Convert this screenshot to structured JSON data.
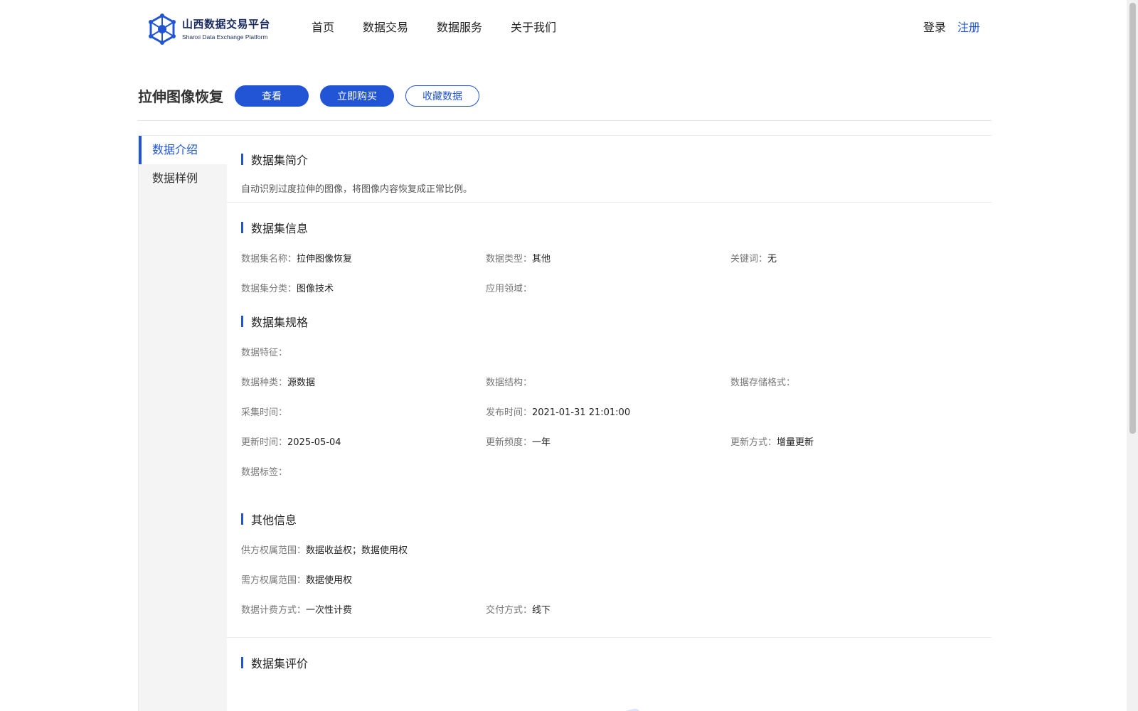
{
  "brand": {
    "name_cn": "山西数据交易平台",
    "name_en": "Shanxi Data Exchange Platform",
    "logo_icon": "hexagon-network-logo",
    "color": "#2155d6"
  },
  "nav": {
    "items": [
      {
        "label": "首页"
      },
      {
        "label": "数据交易"
      },
      {
        "label": "数据服务"
      },
      {
        "label": "关于我们"
      }
    ]
  },
  "auth": {
    "login": "登录",
    "register": "注册"
  },
  "dataset": {
    "title": "拉伸图像恢复",
    "actions": {
      "view": "查看",
      "buy": "立即购买",
      "favorite": "收藏数据"
    }
  },
  "sidebar": {
    "items": [
      {
        "label": "数据介绍",
        "active": true
      },
      {
        "label": "数据样例",
        "active": false
      }
    ]
  },
  "sections": {
    "intro": {
      "title": "数据集简介",
      "text": "自动识别过度拉伸的图像，将图像内容恢复成正常比例。"
    },
    "info": {
      "title": "数据集信息",
      "name_k": "数据集名称：",
      "name_v": "拉伸图像恢复",
      "type_k": "数据类型：",
      "type_v": "其他",
      "kw_k": "关键词：",
      "kw_v": "无",
      "cat_k": "数据集分类：",
      "cat_v": "图像技术",
      "field_k": "应用领域：",
      "field_v": ""
    },
    "spec": {
      "title": "数据集规格",
      "feature_k": "数据特征：",
      "feature_v": "",
      "kind_k": "数据种类：",
      "kind_v": "源数据",
      "struct_k": "数据结构：",
      "struct_v": "",
      "format_k": "数据存储格式：",
      "format_v": "",
      "collect_k": "采集时间：",
      "collect_v": "",
      "publish_k": "发布时间：",
      "publish_v": "2021-01-31 21:01:00",
      "update_k": "更新时间：",
      "update_v": "2025-05-04",
      "freq_k": "更新频度：",
      "freq_v": "一年",
      "mode_k": "更新方式：",
      "mode_v": "增量更新",
      "tag_k": "数据标签：",
      "tag_v": ""
    },
    "other": {
      "title": "其他信息",
      "supply_k": "供方权属范围：",
      "supply_v": "数据收益权；数据使用权",
      "demand_k": "需方权属范围：",
      "demand_v": "数据使用权",
      "billing_k": "数据计费方式：",
      "billing_v": "一次性计费",
      "delivery_k": "交付方式：",
      "delivery_v": "线下"
    },
    "rating": {
      "title": "数据集评价"
    }
  }
}
